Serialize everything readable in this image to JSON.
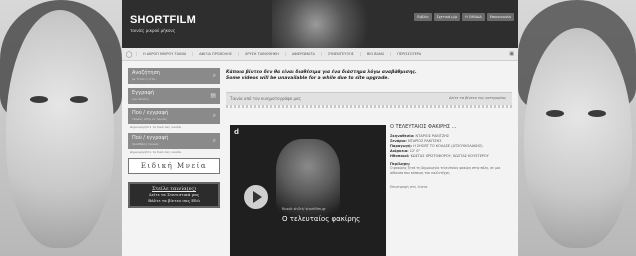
{
  "brand": {
    "name": "SHORTFILM",
    "tagline": "ταινίες μικρού μήκους"
  },
  "top_links": [
    "Βιβλίο",
    "Σχετικά μ/μ",
    "Η ΟΜΑΔΑ",
    "Επικοινωνία"
  ],
  "nav": {
    "home_icon": "home-icon",
    "items": [
      "Η ΑΚΡΟΠ ΜΙΚΡΟΥ ΤΑΙΝΙΑ",
      "ΑΦΙΞΙΑ ΠΡΟΒΟΛΗΣ",
      "ΧΡΥΣΗ ΤΑΙΝΟΘΗΚΗ",
      "ΑΦΙΕΡΩΜΑΤΑ",
      "ΣΥΝΕΝΤΕΥΞΕΙΣ",
      "BIG BANG",
      "ΠΕΡΙΣΣΟΤΕΡΑ"
    ],
    "end_icon": "rss-icon"
  },
  "sidebar": {
    "boxes": [
      {
        "title": "Αναζήτηση",
        "sub": "με τίτλο η τιτλ..",
        "icon": "search-icon"
      },
      {
        "title": "Εγγραφή",
        "sub": "για ταινίες",
        "icon": "lock-icon"
      },
      {
        "title": "Πού / εγγραφή",
        "sub": "ταινίες στην εν ταινίες",
        "icon": "search-icon"
      },
      {
        "title": "Πού / εγγραφή",
        "sub": "προσθήκη ταινίας",
        "icon": "search-icon"
      }
    ],
    "notes": [
      "Δημιουργήστε τα δικά σας κανάλι",
      "Δημιουργήστε τα δικά σας κανάλι"
    ],
    "special": "Ειδική Μνεία",
    "ad": {
      "title": "Στείλε ταινία(ες)",
      "line1": "Δείτε τα Στατιστικά μας",
      "line2": "Βάλτε τα βίντεο σας Εδώ"
    }
  },
  "notice": {
    "greek": "Κάποια βίντεο δεν θα είναι διαθέσιμα για ένα διάστημα λόγω αναβάθμισης.",
    "english": "Some videos will be unavailable for a while due to site upgrade."
  },
  "list_header": {
    "label": "Ταινία από τον κινηματογράφο μας",
    "link": "Δείτε τα βίντεο της κατηγορίας"
  },
  "video": {
    "logo": "d",
    "url": "Russit shOrt/ shortfilm.gr",
    "title": "Ο τελευταίος φακίρης"
  },
  "details": {
    "title": "Ο ΤΕΛΕΥΤΑΙΟΣ ΦΑΚΙΡΗΣ ...",
    "rows": [
      {
        "label": "Σκηνοθεσία:",
        "value": "ΝΤΑΡΙΟΣ ΡΑΚΙΤΖΗΣ"
      },
      {
        "label": "Σενάριο:",
        "value": "ΝΤΑΡΙΟΣ ΡΑΚΙΤΖΗΣ"
      },
      {
        "label": "Παραγωγή:",
        "value": "Η ΣΗΟRT ΤΟ ΚΟΛΑΣΕ (ΑΤΣΟΥΚΟΛΑΚΗΣ)"
      },
      {
        "label": "Διάρκεια:",
        "value": "12' 0''"
      },
      {
        "label": "Ηθοποιοί:",
        "value": "ΚΩΣΤΑΣ ΧΡΙΣΤΟΦΟΡΟΥ, ΚΩΣΤΑΣ ΚΟΥΣΤΕΡΟΥ"
      }
    ],
    "plot_heading": "Περίληψη:",
    "plot": "Ο φακίρης ζητά τη δημιουργία τελευταίας φακίρη στην πόλη, σε μια αίθουσα που κάποιος του καλλιτέχνη.",
    "back": "Επιστροφή στη λίστα"
  }
}
